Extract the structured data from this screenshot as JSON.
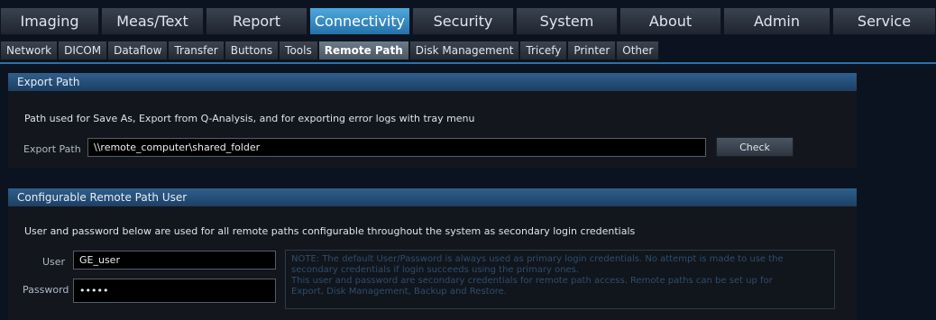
{
  "top_tabs": [
    {
      "label": "Imaging",
      "active": false
    },
    {
      "label": "Meas/Text",
      "active": false
    },
    {
      "label": "Report",
      "active": false
    },
    {
      "label": "Connectivity",
      "active": true
    },
    {
      "label": "Security",
      "active": false
    },
    {
      "label": "System",
      "active": false
    },
    {
      "label": "About",
      "active": false
    },
    {
      "label": "Admin",
      "active": false
    },
    {
      "label": "Service",
      "active": false
    }
  ],
  "sub_tabs": [
    {
      "label": "Network",
      "active": false
    },
    {
      "label": "DICOM",
      "active": false
    },
    {
      "label": "Dataflow",
      "active": false
    },
    {
      "label": "Transfer",
      "active": false
    },
    {
      "label": "Buttons",
      "active": false
    },
    {
      "label": "Tools",
      "active": false
    },
    {
      "label": "Remote Path",
      "active": true
    },
    {
      "label": "Disk Management",
      "active": false
    },
    {
      "label": "Tricefy",
      "active": false
    },
    {
      "label": "Printer",
      "active": false
    },
    {
      "label": "Other",
      "active": false
    }
  ],
  "export_panel": {
    "title": "Export Path",
    "description": "Path used for Save As, Export from Q-Analysis, and for exporting error logs with tray menu",
    "field_label": "Export Path",
    "field_value": "\\\\remote_computer\\shared_folder",
    "check_label": "Check"
  },
  "user_panel": {
    "title": "Configurable Remote Path User",
    "description": "User and password below are used for all remote paths configurable throughout the system as secondary login credentials",
    "user_label": "User",
    "user_value": "GE_user",
    "password_label": "Password",
    "password_value": "•••••",
    "note_lines": [
      "NOTE: The default User/Password is always used as primary login credentials. No attempt is made to use the",
      "secondary credentials if login succeeds using the primary ones.",
      "This user and password are secondary credentials for remote path access. Remote paths can be set up for",
      "Export, Disk Management, Backup and Restore."
    ]
  },
  "colors": {
    "accent": "#2c72a8",
    "active_tab": "#3a8ccb",
    "panel_header": "#274f78",
    "background": "#0c1320"
  }
}
